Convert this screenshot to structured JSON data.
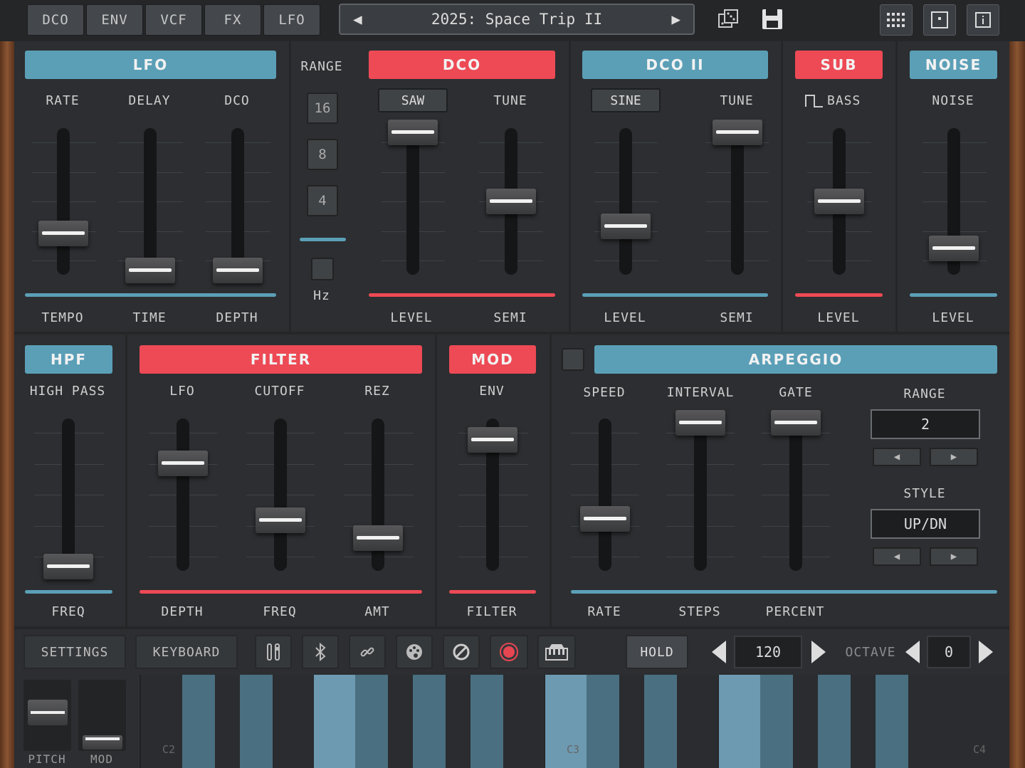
{
  "tabs": [
    "DCO",
    "ENV",
    "VCF",
    "FX",
    "LFO"
  ],
  "preset": {
    "name": "2025: Space Trip II",
    "prev": "◀",
    "next": "▶"
  },
  "top_icons": {
    "dice": "dice-icon",
    "save": "save-icon",
    "grid": "grid-icon",
    "frame": "frame-icon",
    "info": "info-icon"
  },
  "lfo": {
    "header": "LFO",
    "rate": "RATE",
    "delay": "DELAY",
    "dco": "DCO",
    "tempo": "TEMPO",
    "time": "TIME",
    "depth": "DEPTH",
    "rate_value": 0.27,
    "delay_value": 0.0,
    "depth_value": 0.0
  },
  "range": {
    "title": "RANGE",
    "options": [
      "16",
      "8",
      "4"
    ],
    "unit": "Hz"
  },
  "dco": {
    "header": "DCO",
    "wave": "SAW",
    "tune": "TUNE",
    "level": "LEVEL",
    "semi": "SEMI",
    "level_value": 1.0,
    "semi_value": 0.5
  },
  "dco2": {
    "header": "DCO II",
    "wave": "SINE",
    "tune": "TUNE",
    "level": "LEVEL",
    "semi": "SEMI",
    "level_value": 0.32,
    "semi_value": 1.0
  },
  "sub": {
    "header": "SUB",
    "mode": "BASS",
    "level": "LEVEL",
    "level_value": 0.5
  },
  "noise": {
    "header": "NOISE",
    "label": "NOISE",
    "level": "LEVEL",
    "level_value": 0.16
  },
  "hpf": {
    "header": "HPF",
    "label": "HIGH PASS",
    "freq": "FREQ",
    "freq_value": 0.0
  },
  "filter": {
    "header": "FILTER",
    "lfo": "LFO",
    "cutoff": "CUTOFF",
    "rez": "REZ",
    "depth": "DEPTH",
    "freq": "FREQ",
    "amt": "AMT",
    "lfo_value": 0.72,
    "cutoff_value": 0.32,
    "rez_value": 0.2
  },
  "mod": {
    "header": "MOD",
    "env": "ENV",
    "filter": "FILTER",
    "env_value": 0.88
  },
  "arp": {
    "header": "ARPEGGIO",
    "speed": "SPEED",
    "interval": "INTERVAL",
    "gate": "GATE",
    "range_title": "RANGE",
    "range_value": "2",
    "style_title": "STYLE",
    "style_value": "UP/DN",
    "rate": "RATE",
    "steps": "STEPS",
    "percent": "PERCENT",
    "speed_value": 0.33,
    "interval_value": 1.0,
    "gate_value": 1.0,
    "prev": "◀",
    "next": "▶"
  },
  "controls": {
    "settings": "SETTINGS",
    "keyboard": "KEYBOARD",
    "hold": "HOLD",
    "tempo": "120",
    "octave_label": "OCTAVE",
    "octave_value": "0"
  },
  "wheels": {
    "pitch": "PITCH",
    "mod": "MOD"
  },
  "keyboard": {
    "labels": [
      "C2",
      "C3",
      "C4"
    ]
  },
  "colors": {
    "blue": "#5b9fb7",
    "red": "#ed4a55",
    "key_white": "#2a2c2f",
    "key_blue": "#4a6f81",
    "key_active": "#6d9ab1"
  }
}
